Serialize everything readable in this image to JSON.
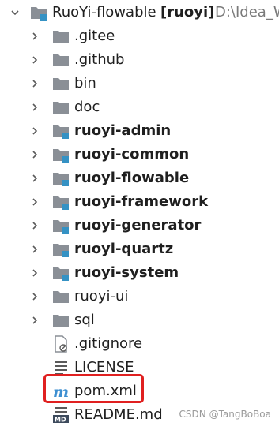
{
  "root": {
    "name": "RuoYi-flowable",
    "module": "[ruoyi]",
    "path": "D:\\Idea_W"
  },
  "items": [
    {
      "label": ".gitee",
      "type": "folder",
      "bold": false
    },
    {
      "label": ".github",
      "type": "folder",
      "bold": false
    },
    {
      "label": "bin",
      "type": "folder",
      "bold": false
    },
    {
      "label": "doc",
      "type": "folder",
      "bold": false
    },
    {
      "label": "ruoyi-admin",
      "type": "module",
      "bold": true
    },
    {
      "label": "ruoyi-common",
      "type": "module",
      "bold": true
    },
    {
      "label": "ruoyi-flowable",
      "type": "module",
      "bold": true
    },
    {
      "label": "ruoyi-framework",
      "type": "module",
      "bold": true
    },
    {
      "label": "ruoyi-generator",
      "type": "module",
      "bold": true
    },
    {
      "label": "ruoyi-quartz",
      "type": "module",
      "bold": true
    },
    {
      "label": "ruoyi-system",
      "type": "module",
      "bold": true
    },
    {
      "label": "ruoyi-ui",
      "type": "folder",
      "bold": false
    },
    {
      "label": "sql",
      "type": "folder",
      "bold": false
    },
    {
      "label": ".gitignore",
      "type": "gitignore-file",
      "bold": false
    },
    {
      "label": "LICENSE",
      "type": "text-file",
      "bold": false
    },
    {
      "label": "pom.xml",
      "type": "maven-file",
      "bold": false
    },
    {
      "label": "README.md",
      "type": "markdown-file",
      "bold": false
    }
  ],
  "watermark": "CSDN @TangBoBoa",
  "colors": {
    "folder": "#8a8f96",
    "module_badge": "#3592c4",
    "chevron": "#5a5a5a",
    "highlight": "#e02020",
    "maven_m": "#3d8fd1"
  }
}
